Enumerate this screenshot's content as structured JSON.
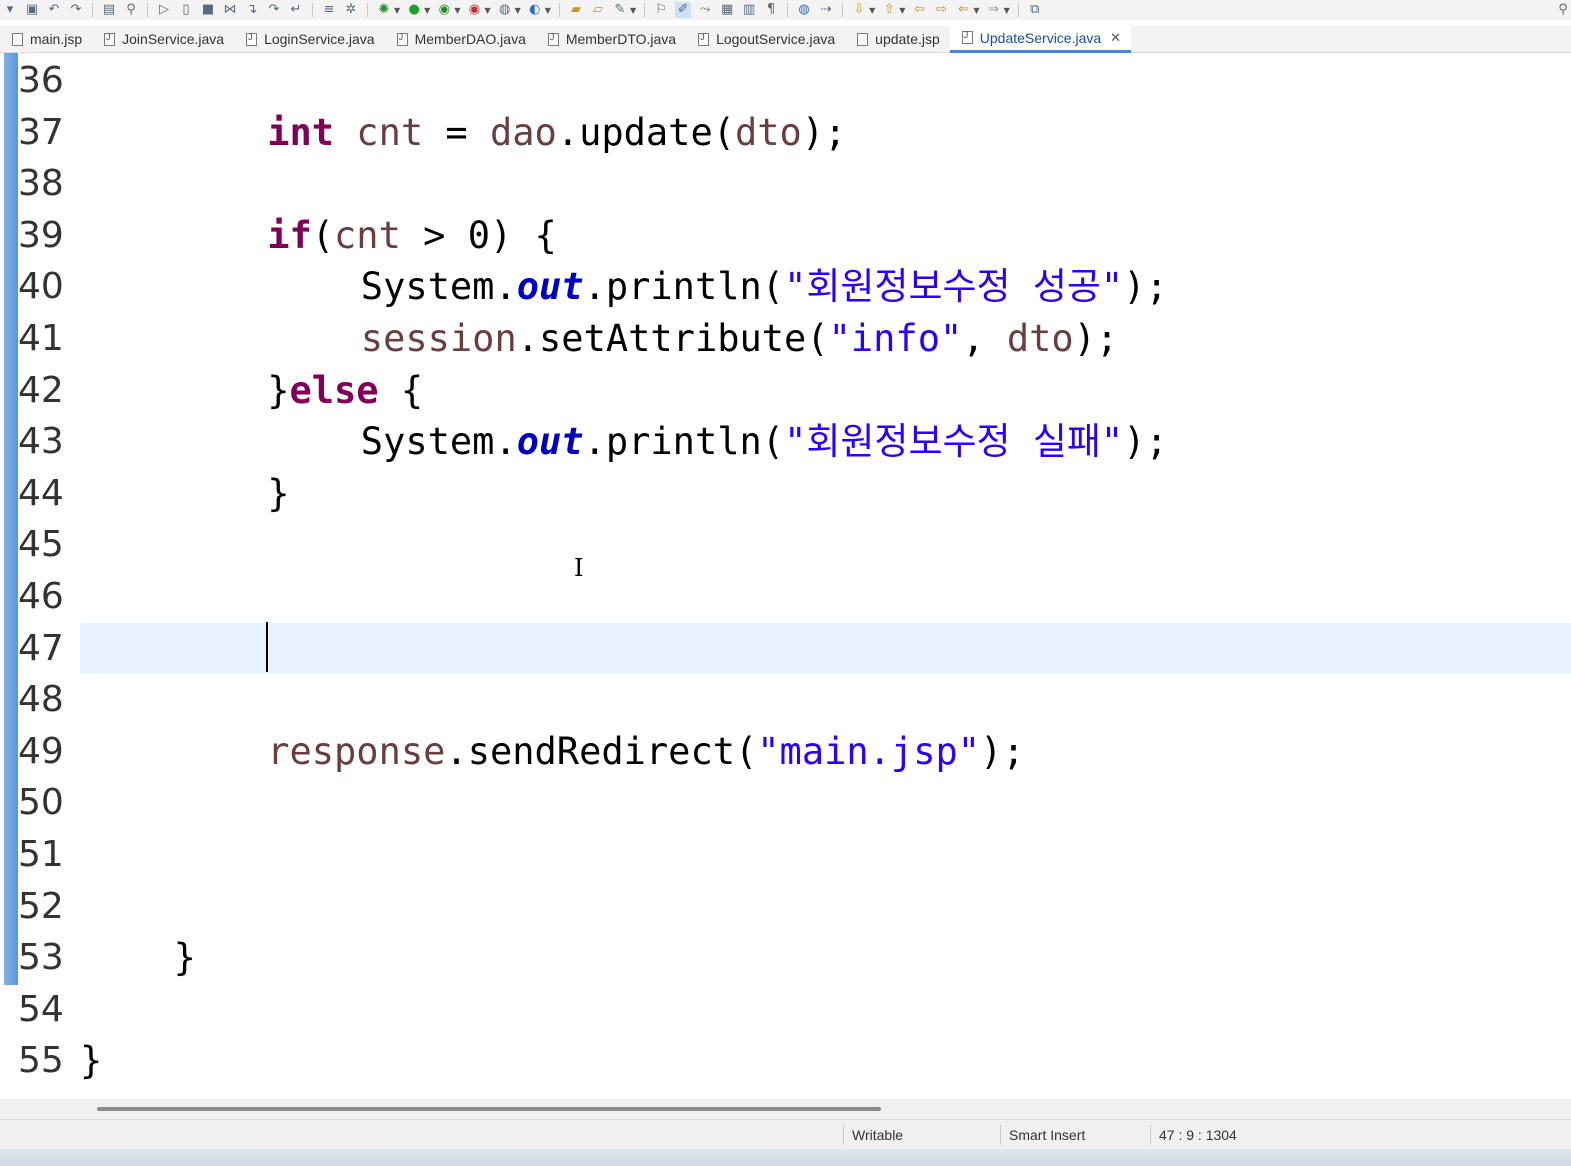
{
  "toolbar": {
    "icons": [
      "save-icon",
      "save-all-icon",
      "undo-icon",
      "redo-icon",
      "console-icon",
      "search-icon",
      "resume-icon",
      "suspend-icon",
      "terminate-icon",
      "disconnect-icon",
      "step-into-icon",
      "step-over-icon",
      "step-return-icon",
      "format-icon",
      "debug-icon",
      "run-icon",
      "run-config-icon",
      "external-tools-icon",
      "new-server-icon",
      "new-java-icon",
      "open-folder-icon",
      "open-type-icon",
      "pin-icon",
      "highlight-icon",
      "annotation-icon",
      "task-icon",
      "outline-icon",
      "pilcrow-icon",
      "globe-icon",
      "nav-icon",
      "next-annotation-icon",
      "prev-annotation-icon",
      "back-icon",
      "forward-icon",
      "back-arrow-icon",
      "forward-arrow-icon",
      "new-window-icon"
    ]
  },
  "tabs": [
    {
      "label": "main.jsp",
      "type": "jsp",
      "active": false
    },
    {
      "label": "JoinService.java",
      "type": "java",
      "active": false
    },
    {
      "label": "LoginService.java",
      "type": "java",
      "active": false
    },
    {
      "label": "MemberDAO.java",
      "type": "java",
      "active": false
    },
    {
      "label": "MemberDTO.java",
      "type": "java",
      "active": false
    },
    {
      "label": "LogoutService.java",
      "type": "java",
      "active": false
    },
    {
      "label": "update.jsp",
      "type": "jsp",
      "active": false
    },
    {
      "label": "UpdateService.java",
      "type": "java",
      "active": true,
      "close": "✕"
    }
  ],
  "editor": {
    "lines": [
      {
        "num": "36",
        "code": ""
      },
      {
        "num": "37",
        "code": "int cnt = dao.update(dto);"
      },
      {
        "num": "38",
        "code": ""
      },
      {
        "num": "39",
        "code": "if(cnt > 0) {"
      },
      {
        "num": "40",
        "code": "System.out.println(\"회원정보수정 성공\");"
      },
      {
        "num": "41",
        "code": "session.setAttribute(\"info\", dto);"
      },
      {
        "num": "42",
        "code": "}else {"
      },
      {
        "num": "43",
        "code": "System.out.println(\"회원정보수정 실패\");"
      },
      {
        "num": "44",
        "code": "}"
      },
      {
        "num": "45",
        "code": ""
      },
      {
        "num": "46",
        "code": ""
      },
      {
        "num": "47",
        "code": ""
      },
      {
        "num": "48",
        "code": ""
      },
      {
        "num": "49",
        "code": "response.sendRedirect(\"main.jsp\");"
      },
      {
        "num": "50",
        "code": ""
      },
      {
        "num": "51",
        "code": ""
      },
      {
        "num": "52",
        "code": ""
      },
      {
        "num": "53",
        "code": "}"
      },
      {
        "num": "54",
        "code": ""
      },
      {
        "num": "55",
        "code": "}"
      }
    ],
    "current_line": "47"
  },
  "status": {
    "mode": "Writable",
    "insert": "Smart Insert",
    "position": "47 : 9 : 1304"
  },
  "colors": {
    "keyword": "#7f0055",
    "string": "#2a00ff",
    "field": "#0000c0",
    "variable": "#6a3e3e",
    "current_line_bg": "#e8f2fe",
    "active_tab": "#4f7fd6"
  }
}
